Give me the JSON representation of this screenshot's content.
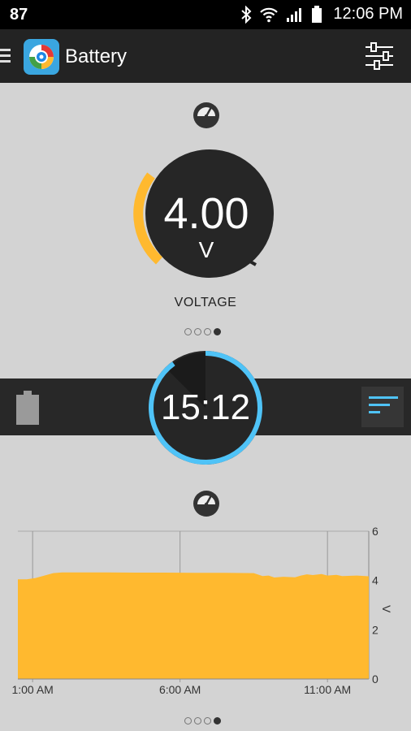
{
  "status_bar": {
    "notification_count": "87",
    "time": "12:06 PM",
    "icons": [
      "bluetooth-icon",
      "wifi-icon",
      "signal-icon",
      "battery-icon"
    ]
  },
  "app_bar": {
    "title": "Battery",
    "icons": [
      "menu-icon",
      "app-logo-icon",
      "settings-sliders-icon"
    ]
  },
  "voltage_gauge": {
    "value": "4.00",
    "unit": "V",
    "label": "VOLTAGE",
    "fill_fraction": 0.2,
    "accent_color": "#ffb92f"
  },
  "timer": {
    "value": "15:12",
    "ring_color": "#4fc3f7",
    "progress_fraction": 0.9
  },
  "pager": {
    "page_count": 4,
    "active_index": 3
  },
  "chart_data": {
    "type": "area",
    "x_tick_labels": [
      "1:00 AM",
      "6:00 AM",
      "11:00 AM"
    ],
    "y_tick_labels": [
      "6",
      "4",
      "2",
      "0"
    ],
    "ylabel": "V",
    "ylim": [
      0,
      6
    ],
    "grid": true,
    "fill_color": "#ffb92f",
    "x_hours": [
      0,
      0.3,
      0.6,
      0.9,
      1.2,
      1.5,
      2,
      3,
      4,
      5,
      6,
      7,
      8,
      8.3,
      8.5,
      8.7,
      9,
      9.4,
      9.6,
      9.8,
      10,
      10.3,
      10.5,
      10.8,
      11,
      11.5,
      11.9
    ],
    "values": [
      4.05,
      4.05,
      4.1,
      4.2,
      4.3,
      4.33,
      4.33,
      4.33,
      4.32,
      4.32,
      4.31,
      4.31,
      4.3,
      4.18,
      4.2,
      4.12,
      4.15,
      4.13,
      4.2,
      4.25,
      4.22,
      4.26,
      4.2,
      4.23,
      4.18,
      4.2,
      4.17
    ]
  }
}
